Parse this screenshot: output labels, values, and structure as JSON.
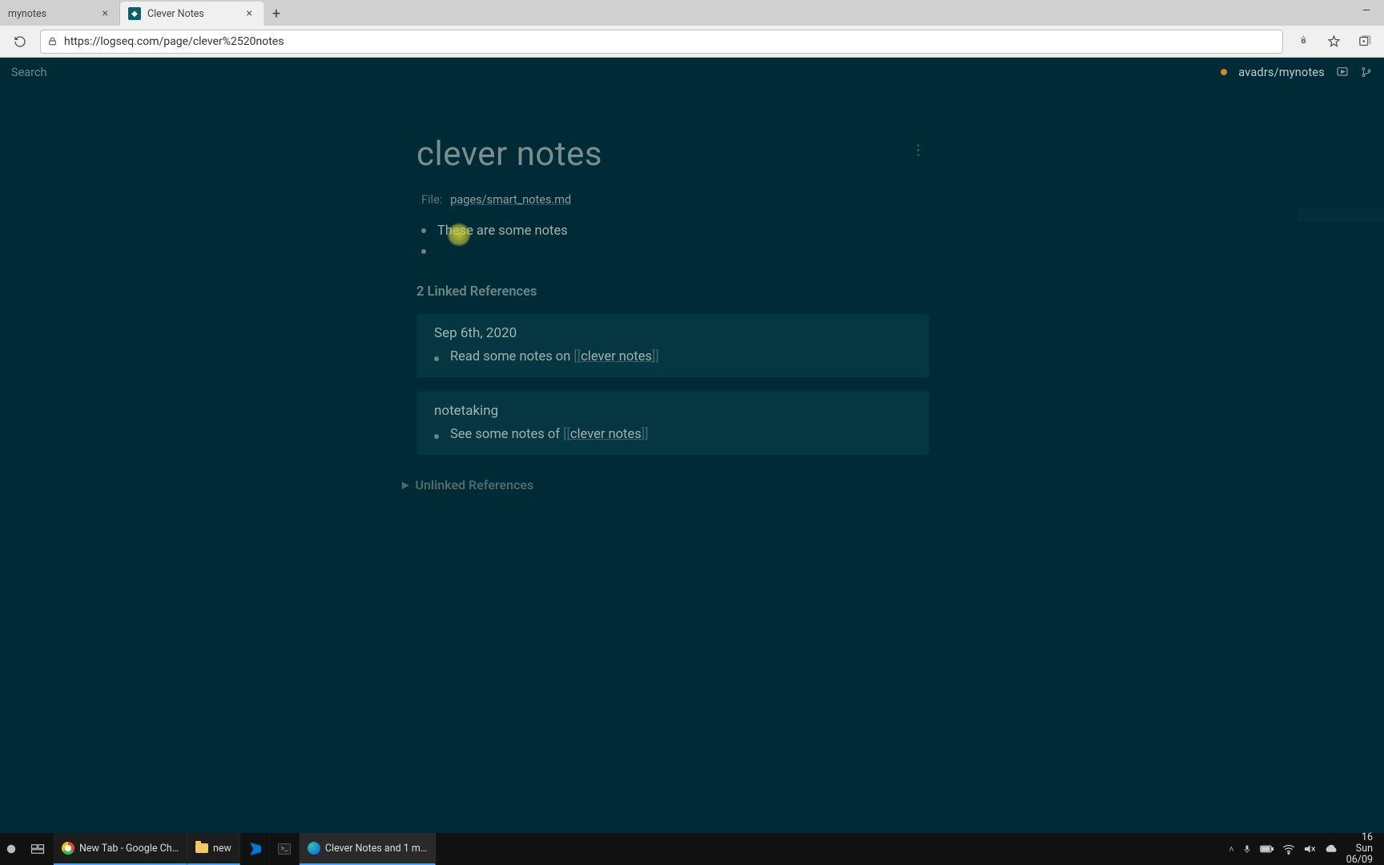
{
  "browser": {
    "tabs": [
      {
        "title": "mynotes",
        "active": false
      },
      {
        "title": "Clever Notes",
        "active": true
      }
    ],
    "url": "https://logseq.com/page/clever%2520notes"
  },
  "app": {
    "search_placeholder": "Search",
    "repo": "avadrs/mynotes"
  },
  "page": {
    "title": "clever notes",
    "file_label": "File:",
    "file_path": "pages/smart_notes.md",
    "blocks": [
      "These are some notes",
      ""
    ],
    "linked_header": "2 Linked References",
    "linked_refs": [
      {
        "title": "Sep 6th, 2020",
        "text_prefix": "Read some notes on ",
        "link_inner": "clever notes"
      },
      {
        "title": "notetaking",
        "text_prefix": "See some notes of ",
        "link_inner": "clever notes"
      }
    ],
    "unlinked_header": "Unlinked References"
  },
  "taskbar": {
    "items": [
      {
        "label": "New Tab - Google Ch…"
      },
      {
        "label": "new"
      },
      {
        "label": ""
      },
      {
        "label": ""
      },
      {
        "label": "Clever Notes and 1 m…"
      }
    ],
    "clock_time": "16",
    "clock_day": "Sun",
    "clock_date": "06/09"
  }
}
